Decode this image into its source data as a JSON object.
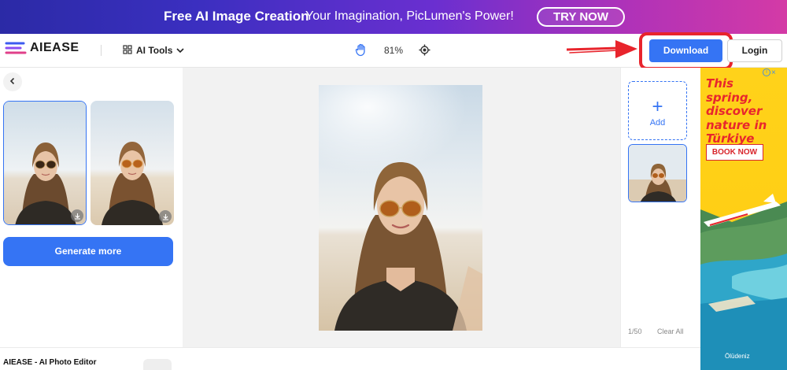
{
  "banner": {
    "title": "Free AI Image Creation",
    "subtitle": "Your Imagination, PicLumen's Power!",
    "cta": "TRY NOW"
  },
  "header": {
    "logo_text": "AIEASE",
    "tools_label": "AI Tools",
    "zoom_level": "81%",
    "download_label": "Download",
    "login_label": "Login"
  },
  "left_panel": {
    "generate_label": "Generate more"
  },
  "right_panel": {
    "add_label": "Add",
    "count": "1/50",
    "clear_label": "Clear All"
  },
  "footer": {
    "title": "AIEASE - AI Photo Editor"
  },
  "ad": {
    "headline": "This spring, discover nature in Türkiye",
    "button": "BOOK NOW",
    "location": "Ölüdeniz",
    "close": "×"
  },
  "colors": {
    "accent": "#3574f4",
    "highlight": "#e8242c",
    "ad_bg": "#ffd21a"
  }
}
